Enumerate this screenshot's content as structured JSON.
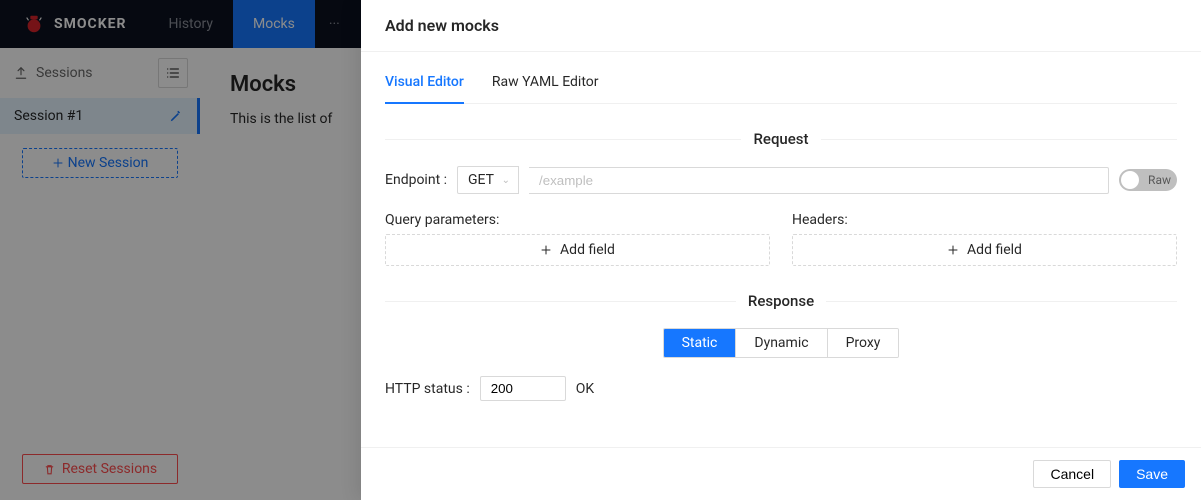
{
  "app": {
    "name": "SMOCKER"
  },
  "nav": {
    "history": "History",
    "mocks": "Mocks",
    "more": "···"
  },
  "sidebar": {
    "sessions_label": "Sessions",
    "session_1": "Session #1",
    "new_session": "New Session",
    "reset_sessions": "Reset Sessions"
  },
  "page": {
    "title": "Mocks",
    "description": "This is the list of"
  },
  "drawer": {
    "title": "Add new mocks",
    "tabs": {
      "visual": "Visual Editor",
      "raw": "Raw YAML Editor"
    },
    "section_request": "Request",
    "section_response": "Response",
    "endpoint_label": "Endpoint :",
    "method": "GET",
    "endpoint_placeholder": "/example",
    "raw_toggle": "Raw",
    "query_label": "Query parameters:",
    "headers_label": "Headers:",
    "add_field": "Add field",
    "response_types": {
      "static": "Static",
      "dynamic": "Dynamic",
      "proxy": "Proxy"
    },
    "status_label": "HTTP status :",
    "status_value": "200",
    "status_text": "OK",
    "cancel": "Cancel",
    "save": "Save"
  }
}
